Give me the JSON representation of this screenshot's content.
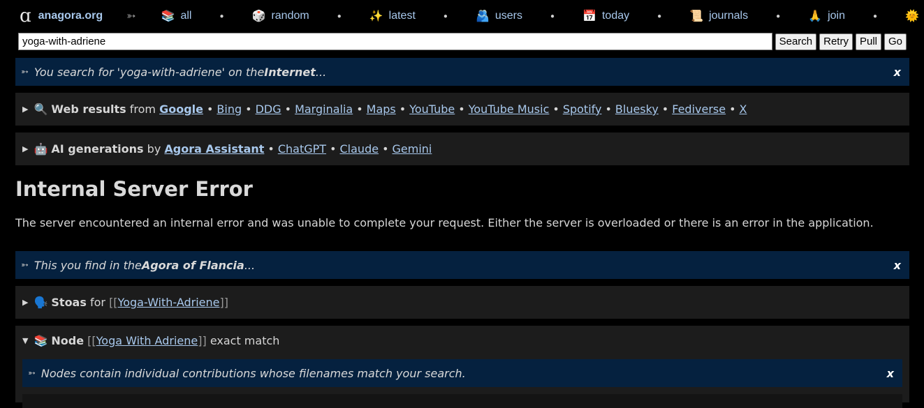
{
  "nav": {
    "logo": "ɑ",
    "site": "anagora.org",
    "arrow": "➳",
    "items": [
      {
        "emoji": "📚",
        "label": "all"
      },
      {
        "emoji": "🎲",
        "label": "random"
      },
      {
        "emoji": "✨",
        "label": "latest"
      },
      {
        "emoji": "🫂",
        "label": "users"
      },
      {
        "emoji": "📅",
        "label": "today"
      },
      {
        "emoji": "📜",
        "label": "journals"
      },
      {
        "emoji": "🙏",
        "label": "join"
      }
    ],
    "theme_icon": "🌞"
  },
  "search": {
    "value": "yoga-with-adriene",
    "buttons": [
      "Search",
      "Retry",
      "Pull",
      "Go"
    ]
  },
  "internet_banner": {
    "icon": "➳",
    "prefix": "You search for 'yoga-with-adriene' on the ",
    "strong": "Internet",
    "suffix": "...",
    "close": "x"
  },
  "web_results": {
    "emoji": "🔍",
    "title": "Web results",
    "from": "from",
    "primary": "Google",
    "links": [
      "Bing",
      "DDG",
      "Marginalia",
      "Maps",
      "YouTube",
      "YouTube Music",
      "Spotify",
      "Bluesky",
      "Fediverse",
      "X"
    ]
  },
  "ai_generations": {
    "emoji": "🤖",
    "title": "AI generations",
    "by": "by",
    "primary": "Agora Assistant",
    "links": [
      "ChatGPT",
      "Claude",
      "Gemini"
    ]
  },
  "error": {
    "title": "Internal Server Error",
    "message": "The server encountered an internal error and was unable to complete your request. Either the server is overloaded or there is an error in the application."
  },
  "agora_banner": {
    "icon": "➳",
    "prefix": "This you find in the ",
    "strong": "Agora of Flancia",
    "suffix": "...",
    "close": "x"
  },
  "stoas": {
    "emoji": "🗣️",
    "title": "Stoas",
    "for": "for",
    "open": "[[",
    "link": "Yoga-With-Adriene",
    "close": "]]"
  },
  "node": {
    "emoji": "📚",
    "title": "Node",
    "open": "[[",
    "link": "Yoga With Adriene",
    "close": "]]",
    "suffix": "exact match",
    "info": "Nodes contain individual contributions whose filenames match your search.",
    "info_icon": "➳",
    "info_close": "x"
  }
}
